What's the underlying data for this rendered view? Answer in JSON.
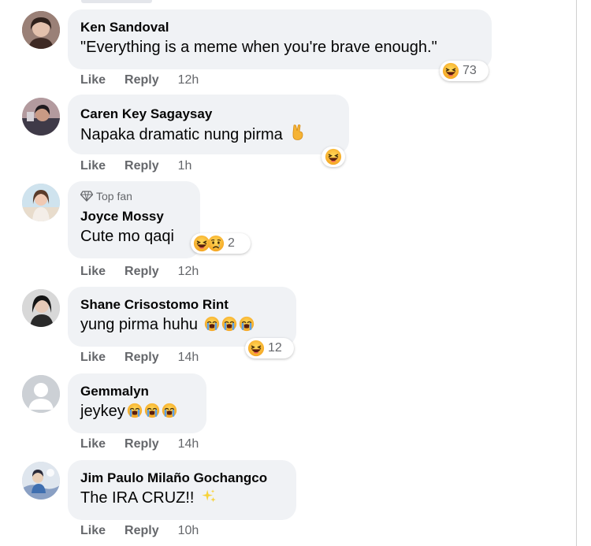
{
  "comments": [
    {
      "author": "Ken Sandoval",
      "text": "\"Everything is a meme when you're brave enough.\"",
      "time": "12h",
      "reaction_count": "73",
      "reaction_icons": [
        "laughing-emoji"
      ]
    },
    {
      "author": "Caren Key Sagaysay",
      "text": "Napaka dramatic nung pirma",
      "text_emoji": [
        "victory-hand-emoji"
      ],
      "time": "1h",
      "reaction_count": "",
      "reaction_icons": [
        "laughing-emoji"
      ]
    },
    {
      "badge": "Top fan",
      "author": "Joyce Mossy",
      "text": "Cute mo qaqi",
      "time": "12h",
      "reaction_count": "2",
      "reaction_icons": [
        "laughing-emoji",
        "crying-emoji"
      ]
    },
    {
      "author": "Shane Crisostomo Rint",
      "text": "yung pirma huhu",
      "text_emoji": [
        "loudly-crying-emoji",
        "loudly-crying-emoji",
        "loudly-crying-emoji"
      ],
      "time": "14h",
      "reaction_count": "12",
      "reaction_icons": [
        "laughing-emoji"
      ]
    },
    {
      "author": "Gemmalyn",
      "text": "jeykey",
      "text_emoji": [
        "loudly-crying-emoji",
        "loudly-crying-emoji",
        "loudly-crying-emoji"
      ],
      "time": "14h"
    },
    {
      "author": "Jim Paulo Milaño Gochangco",
      "text": "The IRA CRUZ!!",
      "text_emoji": [
        "sparkles-emoji"
      ],
      "time": "10h"
    }
  ],
  "actions": {
    "like_label": "Like",
    "reply_label": "Reply"
  },
  "colors": {
    "bubble": "#f0f2f5",
    "meta_text": "#65676b",
    "emoji_yellow": "#f7b125",
    "tear_blue": "#5aa0e6"
  }
}
